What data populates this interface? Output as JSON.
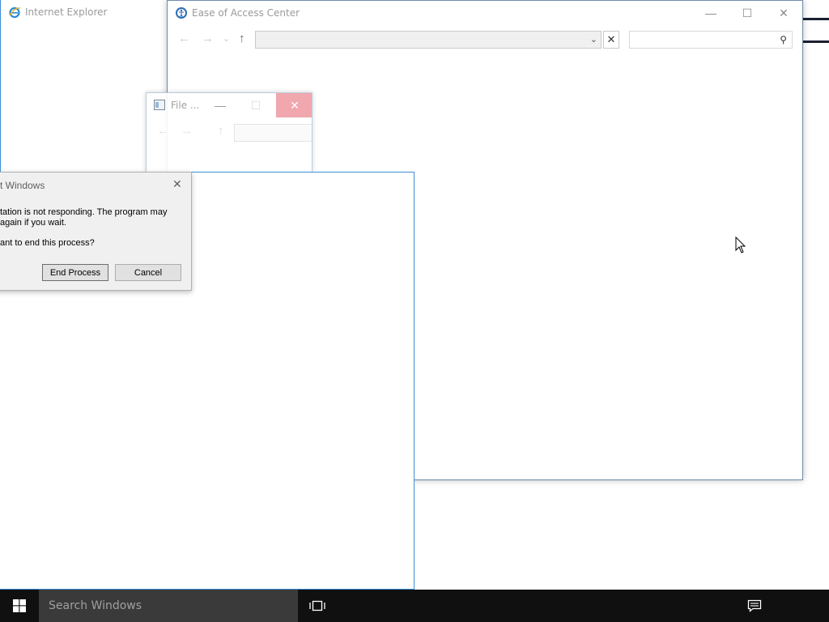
{
  "windows": {
    "internet_explorer": {
      "title": "Internet Explorer"
    },
    "ease_of_access": {
      "title": "Ease of Access Center",
      "address_value": "",
      "search_placeholder": "",
      "nav_back": "←",
      "nav_forward": "→",
      "nav_recent": "⌄",
      "nav_up": "↑",
      "minimize": "—",
      "maximize": "☐",
      "close": "✕",
      "address_clear": "✕",
      "address_dropdown": "⌄",
      "search_icon": "⚲"
    },
    "file_explorer": {
      "title": "File ...",
      "minimize": "—",
      "maximize": "☐",
      "close": "✕",
      "nav_back": "←",
      "nav_forward": "→",
      "nav_up": "↑"
    }
  },
  "dialog": {
    "title": "t Windows",
    "close": "✕",
    "message_line1": "tation is not responding. The program may",
    "message_line2": "again if you wait.",
    "question": "ant to end this process?",
    "end_process_label": "End Process",
    "cancel_label": "Cancel"
  },
  "taskbar": {
    "search_placeholder": "Search Windows",
    "icons": [
      "windows-logo",
      "task-view",
      "action-center"
    ]
  },
  "colors": {
    "taskbar_bg": "#101010",
    "search_bg": "#3a3a3a",
    "window_border_blue": "#3c8fd8",
    "close_hover_red": "#f0a0a8"
  }
}
